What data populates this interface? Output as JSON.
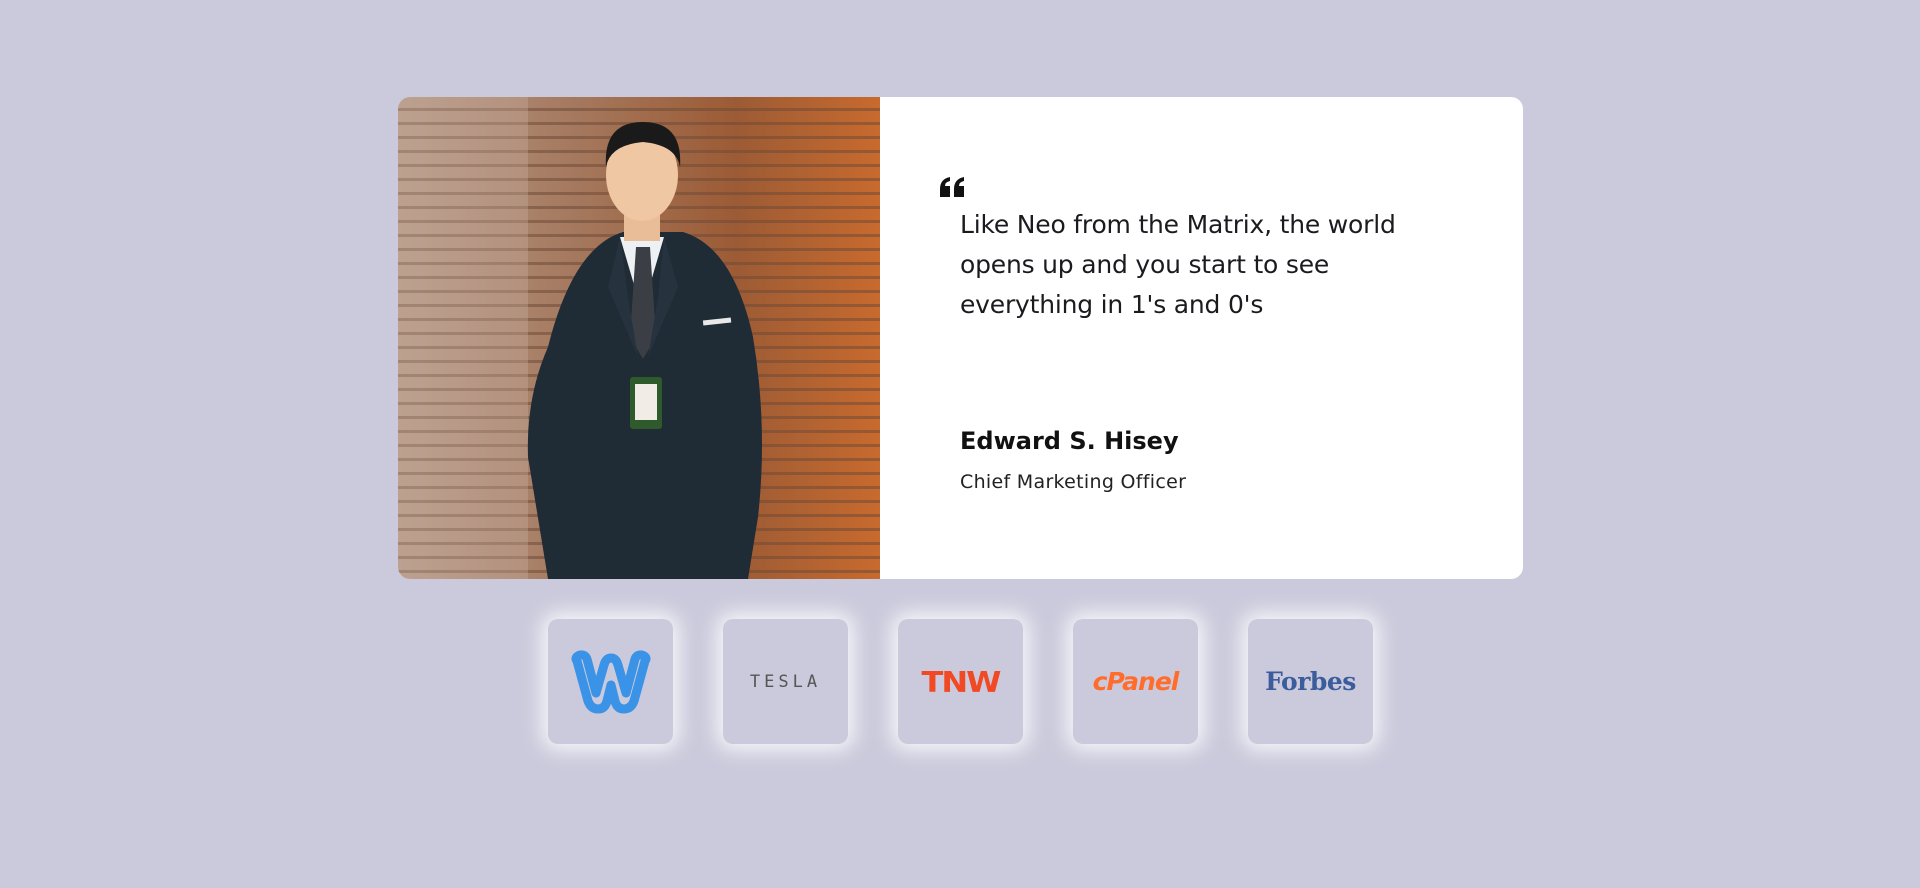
{
  "testimonial": {
    "quote": "Like Neo from the Matrix, the world opens up and you start to see everything in 1's and 0's",
    "author_name": "Edward S. Hisey",
    "author_role": "Chief Marketing Officer"
  },
  "logos": [
    {
      "name": "weebly",
      "text": "",
      "color": "#3a93e6"
    },
    {
      "name": "tesla",
      "text": "TESLA",
      "color": "#555555"
    },
    {
      "name": "tnw",
      "text": "TNW",
      "color": "#f04923"
    },
    {
      "name": "cpanel",
      "text": "cPanel",
      "color": "#ff6c2c"
    },
    {
      "name": "forbes",
      "text": "Forbes",
      "color": "#3b5d9b"
    }
  ],
  "colors": {
    "background": "#cbcadc",
    "card": "#ffffff"
  }
}
